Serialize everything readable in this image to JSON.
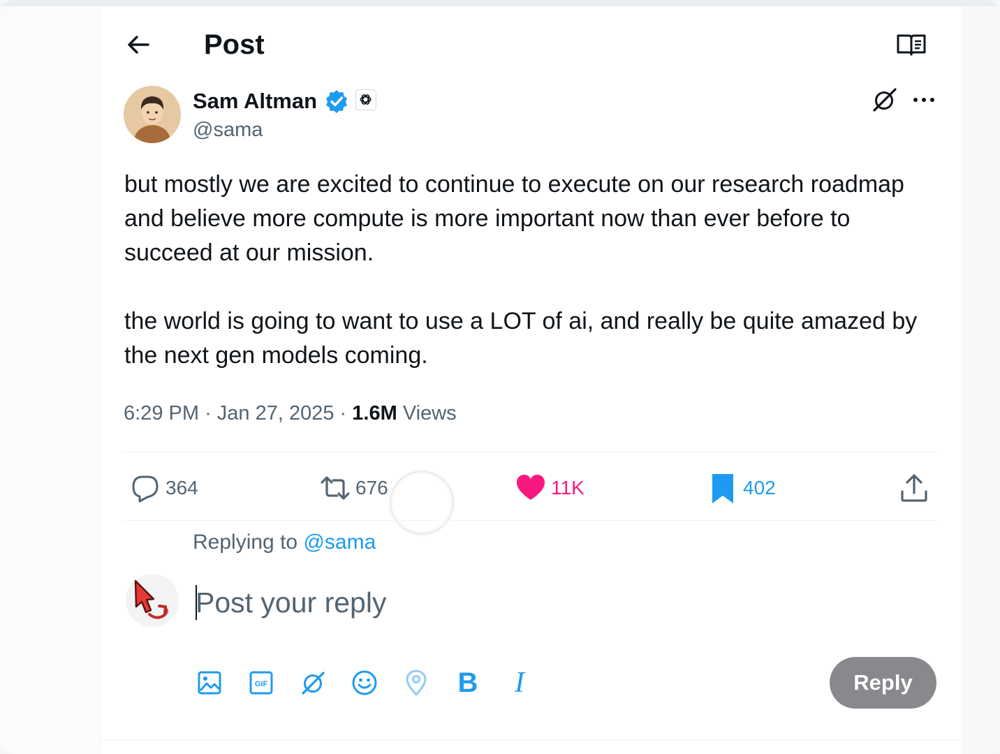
{
  "header": {
    "title": "Post"
  },
  "author": {
    "name": "Sam Altman",
    "handle": "@sama"
  },
  "tweet": {
    "text": "but mostly we are excited to continue to execute on our research roadmap and believe more compute is more important now than ever before to succeed at our mission.\n\nthe world is going to want to use a LOT of ai, and really be quite amazed by the next gen models coming.",
    "time": "6:29 PM",
    "date": "Jan 27, 2025",
    "views_count": "1.6M",
    "views_label": "Views"
  },
  "actions": {
    "replies": "364",
    "reposts": "676",
    "likes": "11K",
    "bookmarks": "402"
  },
  "compose": {
    "replying_prefix": "Replying to",
    "replying_mention": "@sama",
    "placeholder": "Post your reply",
    "reply_button": "Reply",
    "bold_label": "B",
    "italic_label": "I"
  },
  "sidebar": {
    "collapse_label": "»"
  },
  "colors": {
    "accent": "#1d9bf0",
    "like": "#f91880",
    "muted": "#536471",
    "reply_button_bg": "#87898c"
  },
  "icons": [
    "back-arrow-icon",
    "reader-mode-icon",
    "verified-badge-icon",
    "openai-logo-icon",
    "grok-icon",
    "more-icon",
    "reply-icon",
    "repost-icon",
    "like-icon",
    "bookmark-icon",
    "share-icon",
    "image-icon",
    "gif-icon",
    "grok-icon",
    "emoji-icon",
    "location-icon",
    "bold-icon",
    "italic-icon"
  ]
}
